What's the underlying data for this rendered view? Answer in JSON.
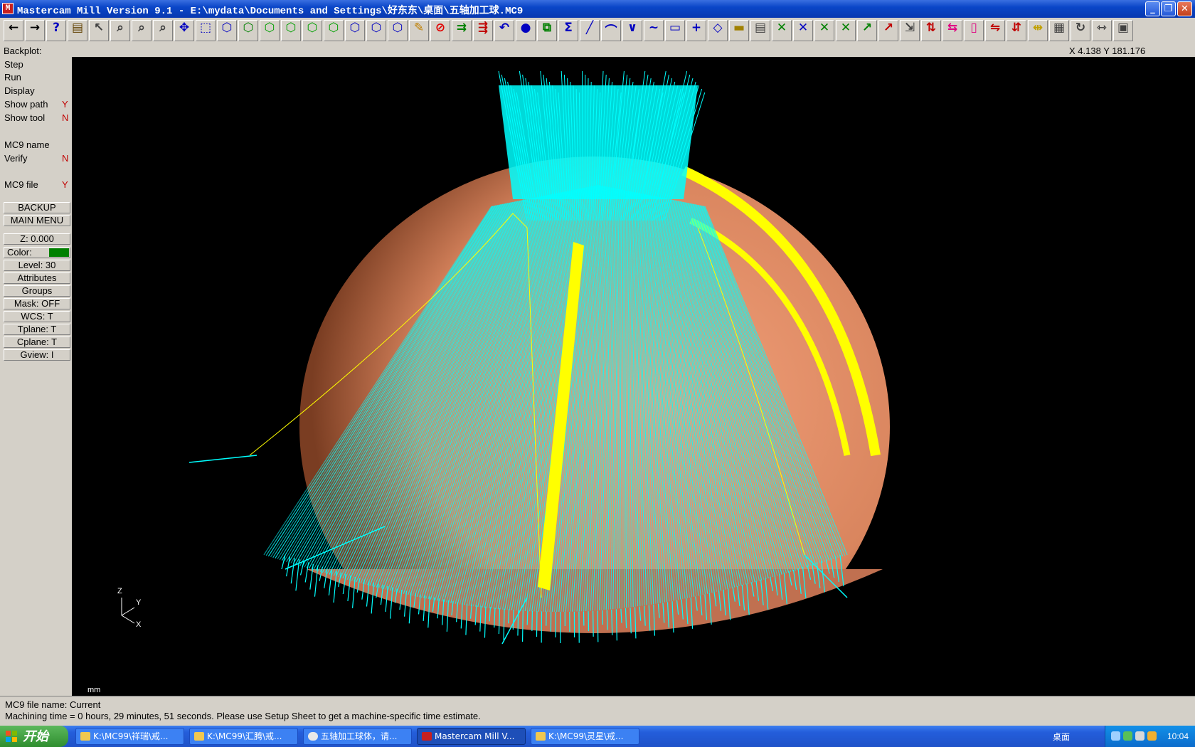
{
  "window": {
    "title": "Mastercam Mill Version 9.1 - E:\\mydata\\Documents and Settings\\好东东\\桌面\\五轴加工球.MC9",
    "icon": "mastercam-icon",
    "buttons": [
      "minimize",
      "restore",
      "close"
    ]
  },
  "toolbar": {
    "icons": [
      "back-arrow-icon",
      "forward-arrow-icon",
      "help-icon",
      "calculator-icon",
      "what-is-icon",
      "zoom-window-icon",
      "zoom-fit-icon",
      "zoom-previous-icon",
      "pan-icon",
      "select-icon",
      "view-isometric-icon",
      "view-top-icon",
      "view-front-icon",
      "view-side-icon",
      "view-3d-icon",
      "cube-1-icon",
      "cube-2-icon",
      "cube-3-icon",
      "cube-4-icon",
      "measure-icon",
      "delete-icon",
      "transform-icon",
      "translate-icon",
      "undo-icon",
      "shade-sphere-icon",
      "copy-icon",
      "sum-icon",
      "line-icon",
      "arc-icon",
      "fillet-icon",
      "spline-icon",
      "rectangle-icon",
      "point-icon",
      "surface-icon",
      "solid-box-icon",
      "levels-icon",
      "trim-1-icon",
      "trim-2-icon",
      "trim-3-icon",
      "trim-4-icon",
      "extend-icon",
      "break-icon",
      "move-icon",
      "mirror-icon",
      "rotate-icon",
      "scale-icon",
      "stretch-icon",
      "offset-icon",
      "split-icon",
      "grid-icon",
      "xyz-icon",
      "dimension-icon",
      "toolbar-end-icon"
    ]
  },
  "status": {
    "mode": "Backplot:",
    "coords": "X 4.138  Y 181.176"
  },
  "menu": {
    "items": [
      {
        "label": "Step",
        "flag": ""
      },
      {
        "label": "Run",
        "flag": ""
      },
      {
        "label": "Display",
        "flag": ""
      },
      {
        "label": "Show path",
        "flag": "Y"
      },
      {
        "label": "Show tool",
        "flag": "N"
      },
      {
        "label": "MC9 name",
        "flag": ""
      },
      {
        "label": "Verify",
        "flag": "N"
      },
      {
        "label": "MC9 file",
        "flag": "Y"
      }
    ],
    "backup": "BACKUP",
    "main_menu": "MAIN MENU"
  },
  "secondary_menu": {
    "z": "Z:   0.000",
    "color": "Color:",
    "color_value": "2",
    "color_swatch": "#008000",
    "level": "Level: 30",
    "attributes": "Attributes",
    "groups": "Groups",
    "mask": "Mask:  OFF",
    "wcs": "WCS:   T",
    "tplane": "Tplane:  T",
    "cplane": "Cplane:  T",
    "gview": "Gview:   I"
  },
  "viewport": {
    "units": "mm",
    "axes": {
      "z": "Z",
      "y": "Y",
      "x": "X"
    },
    "colors": {
      "background": "#000000",
      "toolpath": "#00ffff",
      "sphere": "#e8906a",
      "highlight": "#ffff00"
    }
  },
  "prompt": {
    "line1": "MC9 file name: Current",
    "line2": "Machining time = 0 hours, 29 minutes, 51 seconds. Please use Setup Sheet to get a machine-specific time estimate."
  },
  "taskbar": {
    "start": "开始",
    "tasks": [
      {
        "label": "K:\\MC99\\祥瑞\\戒...",
        "active": false
      },
      {
        "label": "K:\\MC99\\汇腾\\戒...",
        "active": false
      },
      {
        "label": "五轴加工球体，请...",
        "active": false
      },
      {
        "label": "Mastercam Mill V...",
        "active": true
      },
      {
        "label": "K:\\MC99\\灵星\\戒...",
        "active": false
      }
    ],
    "desktop": "桌面",
    "clock": "10:04"
  }
}
